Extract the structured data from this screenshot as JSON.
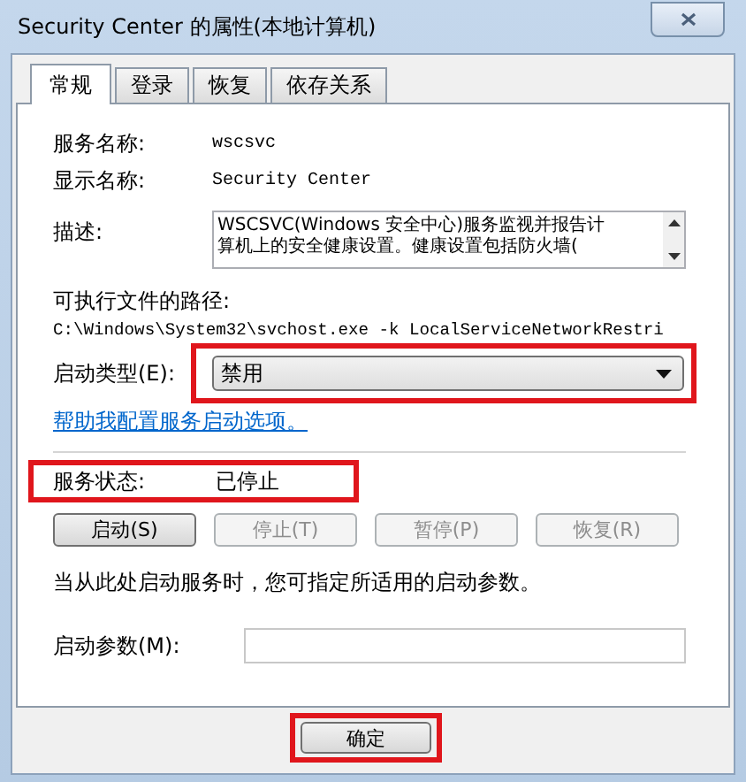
{
  "window": {
    "title": "Security Center 的属性(本地计算机)"
  },
  "tabs": [
    {
      "label": "常规",
      "selected": true
    },
    {
      "label": "登录",
      "selected": false
    },
    {
      "label": "恢复",
      "selected": false
    },
    {
      "label": "依存关系",
      "selected": false
    }
  ],
  "fields": [
    {
      "label": "服务名称:",
      "value": "wscsvc"
    },
    {
      "label": "显示名称:",
      "value": "Security Center"
    }
  ],
  "description": {
    "label": "描述:",
    "lines": [
      "WSCSVC(Windows 安全中心)服务监视并报告计",
      "算机上的安全健康设置。健康设置包括防火墙("
    ]
  },
  "path": {
    "label": "可执行文件的路径:",
    "value": "C:\\Windows\\System32\\svchost.exe -k LocalServiceNetworkRestri"
  },
  "startup_type": {
    "label": "启动类型(E):",
    "value": "禁用",
    "highlighted": true
  },
  "help_link": "帮助我配置服务启动选项。",
  "status": {
    "label": "服务状态:",
    "value": "已停止",
    "highlighted": true
  },
  "service_buttons": [
    {
      "label": "启动(S)",
      "disabled": false
    },
    {
      "label": "停止(T)",
      "disabled": true
    },
    {
      "label": "暂停(P)",
      "disabled": true
    },
    {
      "label": "恢复(R)",
      "disabled": true
    }
  ],
  "hint": "当从此处启动服务时，您可指定所适用的启动参数。",
  "start_params": {
    "label": "启动参数(M):"
  },
  "dialog_buttons": [
    {
      "label": "确定",
      "highlighted": true
    }
  ]
}
